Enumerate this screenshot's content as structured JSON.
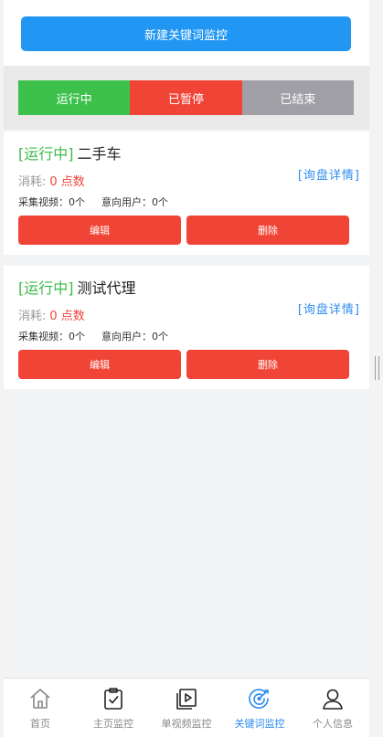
{
  "header": {
    "new_button_label": "新建关键词监控"
  },
  "filter_tabs": [
    {
      "label": "运行中",
      "color": "#3dc14c"
    },
    {
      "label": "已暂停",
      "color": "#f04436"
    },
    {
      "label": "已结束",
      "color": "#a19fa6"
    }
  ],
  "cards": [
    {
      "status": "[运行中]",
      "title": "二手车",
      "cost_label": "消耗:",
      "cost_value": "0 点数",
      "detail_link": "[询盘详情]",
      "videos": "采集视频：0个",
      "users": "意向用户：0个",
      "edit_label": "编辑",
      "delete_label": "删除"
    },
    {
      "status": "[运行中]",
      "title": "测试代理",
      "cost_label": "消耗:",
      "cost_value": "0 点数",
      "detail_link": "[询盘详情]",
      "videos": "采集视频：0个",
      "users": "意向用户：0个",
      "edit_label": "编辑",
      "delete_label": "删除"
    }
  ],
  "tabbar": {
    "items": [
      {
        "label": "首页",
        "icon": "home-icon"
      },
      {
        "label": "主页监控",
        "icon": "clipboard-check-icon"
      },
      {
        "label": "单视频监控",
        "icon": "video-play-icon"
      },
      {
        "label": "关键词监控",
        "icon": "target-icon",
        "active": true
      },
      {
        "label": "个人信息",
        "icon": "user-icon"
      }
    ],
    "active_color": "#2d8cf0"
  }
}
